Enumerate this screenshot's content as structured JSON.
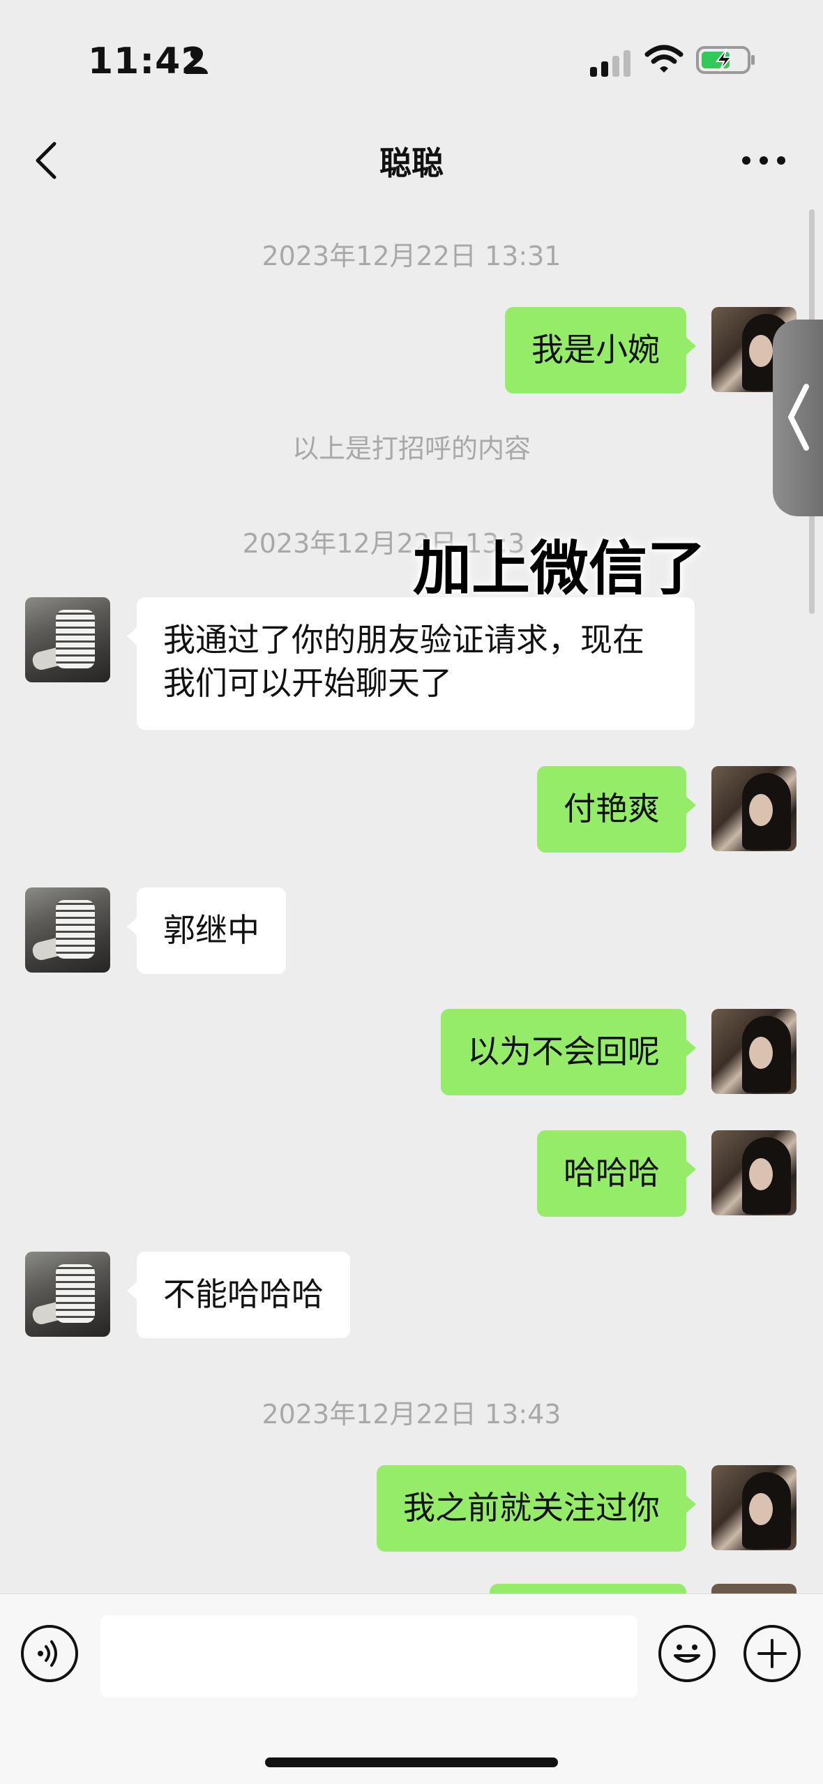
{
  "status_bar": {
    "time": "11:42"
  },
  "nav": {
    "title": "聪聪"
  },
  "timestamps": {
    "t1": "2023年12月22日 13:31",
    "t2": "2023年12月22日 13:3",
    "t3": "2023年12月22日 13:43"
  },
  "system_note": "以上是打招呼的内容",
  "overlay_caption": "加上微信了",
  "messages": [
    {
      "from": "me",
      "text": "我是小婉"
    },
    {
      "from": "friend",
      "text": "我通过了你的朋友验证请求，现在我们可以开始聊天了"
    },
    {
      "from": "me",
      "text": "付艳爽"
    },
    {
      "from": "friend",
      "text": "郭继中"
    },
    {
      "from": "me",
      "text": "以为不会回呢"
    },
    {
      "from": "me",
      "text": "哈哈哈"
    },
    {
      "from": "friend",
      "text": "不能哈哈哈"
    },
    {
      "from": "me",
      "text": "我之前就关注过你"
    }
  ],
  "input": {
    "value": ""
  },
  "icons": {
    "back": "chevron-left-icon",
    "more": "more-dots-icon",
    "voice": "voice-icon",
    "emoji": "emoji-icon",
    "plus": "plus-icon"
  },
  "colors": {
    "me_bubble": "#95ec69",
    "friend_bubble": "#ffffff",
    "background": "#ededed"
  }
}
